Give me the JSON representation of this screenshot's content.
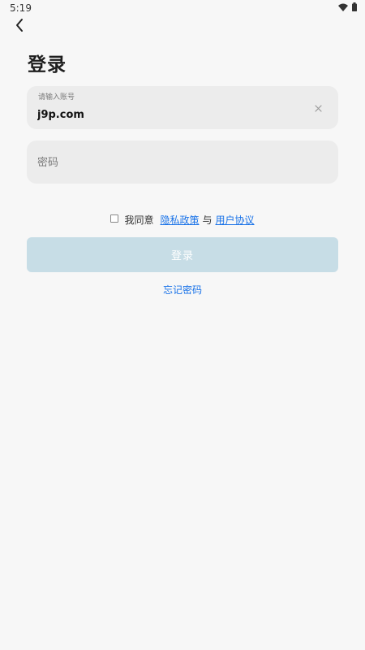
{
  "status_bar": {
    "time": "5:19",
    "wifi_icon": "wifi-icon",
    "battery_icon": "battery-icon"
  },
  "header": {
    "back_icon": "chevron-left-icon",
    "title": "登录"
  },
  "account_field": {
    "label": "请输入账号",
    "value": "j9p.com",
    "clear_icon": "close-icon"
  },
  "password_field": {
    "placeholder": "密码",
    "value": ""
  },
  "agreement": {
    "checked": false,
    "prefix": "我同意",
    "privacy_link": "隐私政策",
    "connector": "与",
    "terms_link": "用户协议"
  },
  "login_button": {
    "label": "登录",
    "enabled": false
  },
  "forgot_password": {
    "label": "忘记密码"
  },
  "colors": {
    "accent": "#1a73e8",
    "button_disabled": "#c7dde6",
    "field_bg": "#ececec",
    "page_bg": "#f7f7f7"
  }
}
